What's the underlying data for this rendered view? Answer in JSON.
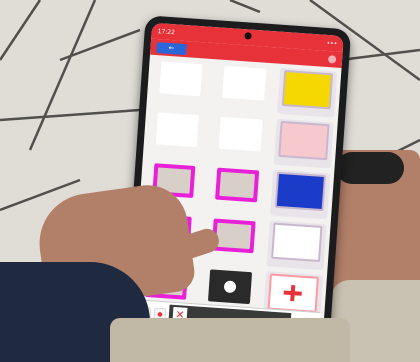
{
  "colors": {
    "app_accent": "#e8323a",
    "back_button": "#2a66d8",
    "tile_highlight": "#e820d8"
  },
  "phone": {
    "status_time": "17:22",
    "status_right": "•••",
    "back_label": "←",
    "menu_icon": "dots-icon"
  },
  "tiles": [
    {
      "style": "t-white",
      "label": "",
      "icon": "no-eating-icon"
    },
    {
      "style": "t-white",
      "label": "",
      "icon": "person-arms-up-icon"
    },
    {
      "style": "t-side t-yellow",
      "label": "",
      "icon": "house-icon"
    },
    {
      "style": "t-white",
      "label": "",
      "icon": "falling-person-icon"
    },
    {
      "style": "t-white",
      "label": "",
      "icon": "photo-icon"
    },
    {
      "style": "t-side t-pink",
      "label": "",
      "icon": "family-icon"
    },
    {
      "style": "t-magenta",
      "label": "",
      "icon": "photo-icon"
    },
    {
      "style": "t-magenta",
      "label": "",
      "icon": "photo-icon"
    },
    {
      "style": "t-side t-blue",
      "label": "",
      "icon": "people-icon"
    },
    {
      "style": "t-magenta",
      "label": "",
      "icon": "photo-icon"
    },
    {
      "style": "t-magenta",
      "label": "",
      "icon": "photo-icon"
    },
    {
      "style": "t-side t-white",
      "label": "",
      "icon": "photo-icon"
    },
    {
      "style": "t-magenta",
      "label": "",
      "icon": "photo-icon"
    },
    {
      "style": "t-dark",
      "label": "",
      "icon": "person-silhouette-icon"
    },
    {
      "style": "t-side t-red-cross",
      "label": "",
      "icon": "medical-cross-icon"
    }
  ],
  "sentence_bar": {
    "delete_label": "●",
    "clear_label": "●",
    "cross_label": "✕",
    "green_label": "●",
    "blue_label": "●"
  }
}
